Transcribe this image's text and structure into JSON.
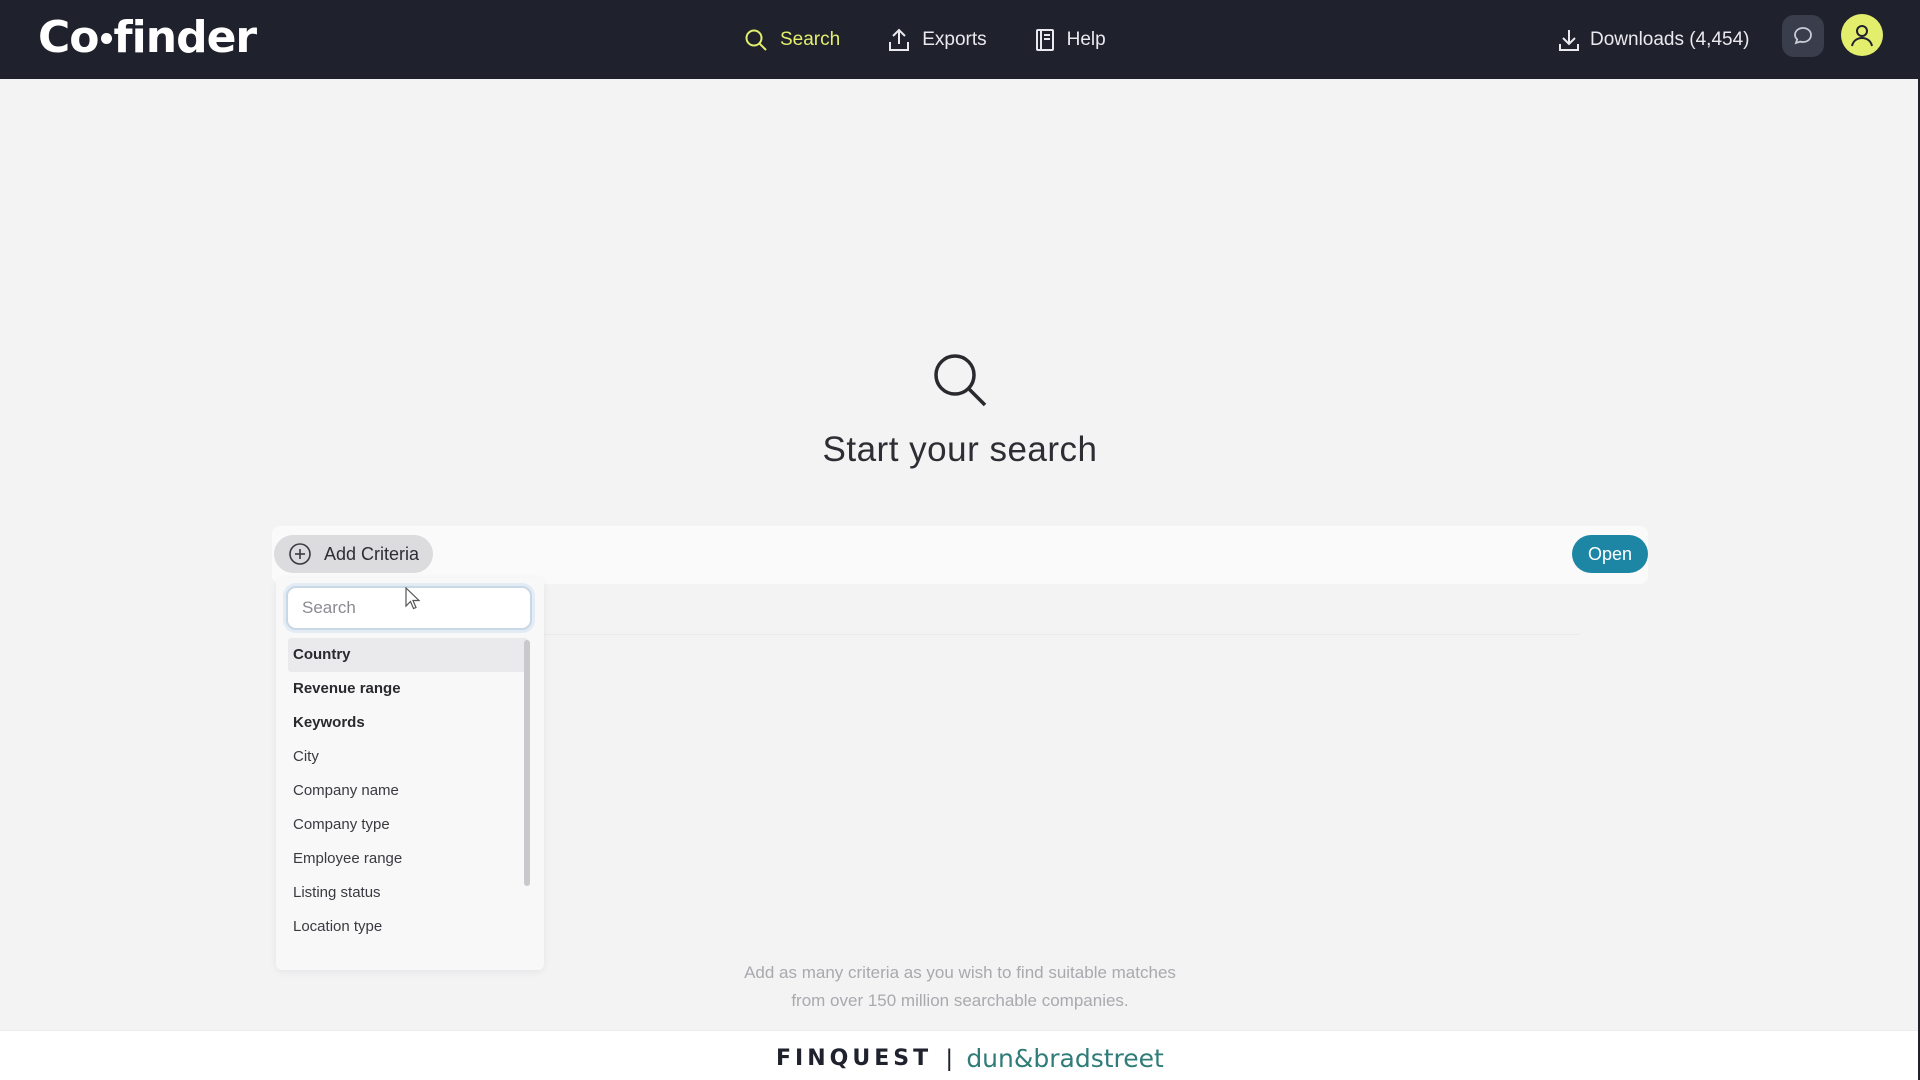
{
  "header": {
    "logo": {
      "part1": "Co",
      "part2": "finder"
    },
    "nav": [
      {
        "label": "Search",
        "icon": "search-icon",
        "active": true
      },
      {
        "label": "Exports",
        "icon": "upload-icon",
        "active": false
      },
      {
        "label": "Help",
        "icon": "book-icon",
        "active": false
      }
    ],
    "downloads_label": "Downloads (4,454)",
    "accent_color": "#e4ee6d"
  },
  "main": {
    "title": "Start your search",
    "add_criteria_label": "Add Criteria",
    "open_label": "Open",
    "hint_line1": "Add as many criteria as you wish to find suitable matches",
    "hint_line2": "from over 150 million searchable companies."
  },
  "dropdown": {
    "search_placeholder": "Search",
    "items": [
      {
        "label": "Country",
        "bold": true
      },
      {
        "label": "Revenue range",
        "bold": true
      },
      {
        "label": "Keywords",
        "bold": true
      },
      {
        "label": "City",
        "bold": false
      },
      {
        "label": "Company name",
        "bold": false
      },
      {
        "label": "Company type",
        "bold": false
      },
      {
        "label": "Employee range",
        "bold": false
      },
      {
        "label": "Listing status",
        "bold": false
      },
      {
        "label": "Location type",
        "bold": false
      }
    ]
  },
  "footer": {
    "brand1": "FINQUEST",
    "separator": "|",
    "brand2": "dun&bradstreet"
  }
}
